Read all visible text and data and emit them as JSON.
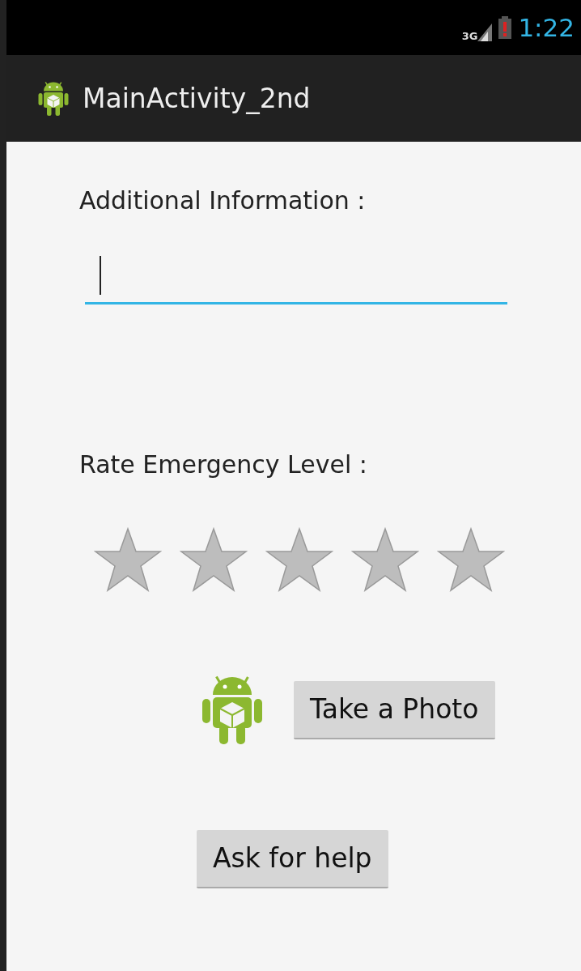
{
  "status_bar": {
    "network": "3G",
    "battery_low": true,
    "time": "1:22"
  },
  "action_bar": {
    "title": "MainActivity_2nd"
  },
  "info": {
    "label": "Additional Information :",
    "focused": true
  },
  "rating": {
    "label": "Rate Emergency Level :",
    "stars": 0
  },
  "buttons": [
    {
      "kind": "photo",
      "label": "Take a Photo"
    },
    {
      "kind": "help",
      "label": "Ask for help"
    }
  ]
}
